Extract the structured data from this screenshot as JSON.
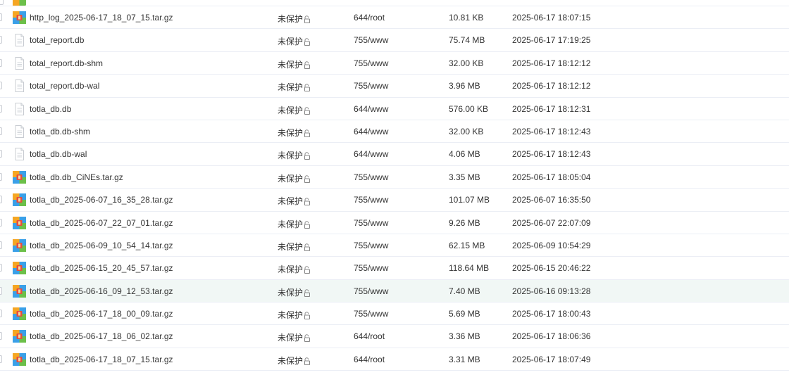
{
  "files": [
    {
      "name": "http_log_2025-06-17_18_07_15.tar.gz",
      "icon": "archive-icon",
      "protect": "未保护",
      "perm": "644/root",
      "size": "10.81 KB",
      "mtime": "2025-06-17 18:07:15"
    },
    {
      "name": "total_report.db",
      "icon": "file-icon",
      "protect": "未保护",
      "perm": "755/www",
      "size": "75.74 MB",
      "mtime": "2025-06-17 17:19:25"
    },
    {
      "name": "total_report.db-shm",
      "icon": "file-icon",
      "protect": "未保护",
      "perm": "755/www",
      "size": "32.00 KB",
      "mtime": "2025-06-17 18:12:12"
    },
    {
      "name": "total_report.db-wal",
      "icon": "file-icon",
      "protect": "未保护",
      "perm": "755/www",
      "size": "3.96 MB",
      "mtime": "2025-06-17 18:12:12"
    },
    {
      "name": "totla_db.db",
      "icon": "file-icon",
      "protect": "未保护",
      "perm": "644/www",
      "size": "576.00 KB",
      "mtime": "2025-06-17 18:12:31"
    },
    {
      "name": "totla_db.db-shm",
      "icon": "file-icon",
      "protect": "未保护",
      "perm": "644/www",
      "size": "32.00 KB",
      "mtime": "2025-06-17 18:12:43"
    },
    {
      "name": "totla_db.db-wal",
      "icon": "file-icon",
      "protect": "未保护",
      "perm": "644/www",
      "size": "4.06 MB",
      "mtime": "2025-06-17 18:12:43"
    },
    {
      "name": "totla_db.db_CiNEs.tar.gz",
      "icon": "archive-icon",
      "protect": "未保护",
      "perm": "755/www",
      "size": "3.35 MB",
      "mtime": "2025-06-17 18:05:04"
    },
    {
      "name": "totla_db_2025-06-07_16_35_28.tar.gz",
      "icon": "archive-icon",
      "protect": "未保护",
      "perm": "755/www",
      "size": "101.07 MB",
      "mtime": "2025-06-07 16:35:50"
    },
    {
      "name": "totla_db_2025-06-07_22_07_01.tar.gz",
      "icon": "archive-icon",
      "protect": "未保护",
      "perm": "755/www",
      "size": "9.26 MB",
      "mtime": "2025-06-07 22:07:09"
    },
    {
      "name": "totla_db_2025-06-09_10_54_14.tar.gz",
      "icon": "archive-icon",
      "protect": "未保护",
      "perm": "755/www",
      "size": "62.15 MB",
      "mtime": "2025-06-09 10:54:29"
    },
    {
      "name": "totla_db_2025-06-15_20_45_57.tar.gz",
      "icon": "archive-icon",
      "protect": "未保护",
      "perm": "755/www",
      "size": "118.64 MB",
      "mtime": "2025-06-15 20:46:22"
    },
    {
      "name": "totla_db_2025-06-16_09_12_53.tar.gz",
      "icon": "archive-icon",
      "protect": "未保护",
      "perm": "755/www",
      "size": "7.40 MB",
      "mtime": "2025-06-16 09:13:28",
      "highlighted": true
    },
    {
      "name": "totla_db_2025-06-17_18_00_09.tar.gz",
      "icon": "archive-icon",
      "protect": "未保护",
      "perm": "755/www",
      "size": "5.69 MB",
      "mtime": "2025-06-17 18:00:43"
    },
    {
      "name": "totla_db_2025-06-17_18_06_02.tar.gz",
      "icon": "archive-icon",
      "protect": "未保护",
      "perm": "644/root",
      "size": "3.36 MB",
      "mtime": "2025-06-17 18:06:36"
    },
    {
      "name": "totla_db_2025-06-17_18_07_15.tar.gz",
      "icon": "archive-icon",
      "protect": "未保护",
      "perm": "644/root",
      "size": "3.31 MB",
      "mtime": "2025-06-17 18:07:49"
    }
  ],
  "colors": {
    "row_border": "#ebeef5",
    "row_highlight": "#f1f7f5",
    "text": "#333333",
    "archive_orange": "#f5a623",
    "archive_blue": "#3aa0e8",
    "archive_green": "#6cc04a",
    "archive_red": "#e94b3c"
  }
}
